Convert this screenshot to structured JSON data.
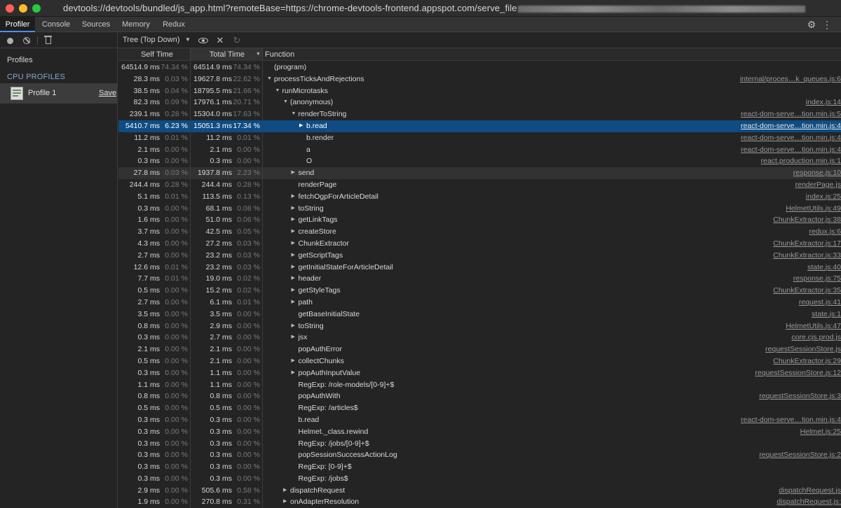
{
  "window": {
    "title": "devtools://devtools/bundled/js_app.html?remoteBase=https://chrome-devtools-frontend.appspot.com/serve_file"
  },
  "tabs": [
    {
      "label": "Profiler",
      "active": true
    },
    {
      "label": "Console",
      "active": false
    },
    {
      "label": "Sources",
      "active": false
    },
    {
      "label": "Memory",
      "active": false
    },
    {
      "label": "Redux",
      "active": false
    }
  ],
  "icons": {
    "settings": "gear-icon",
    "more": "more-vertical-icon",
    "record": "record-icon",
    "clear": "clear-icon",
    "trash": "trash-icon",
    "focus": "eye-icon",
    "exclude": "close-icon",
    "restore": "reload-icon"
  },
  "sidebar": {
    "profiles_label": "Profiles",
    "cpu_profiles_label": "CPU PROFILES",
    "profile_name": "Profile 1",
    "save_label": "Save"
  },
  "toolbar": {
    "view_mode": "Tree (Top Down)"
  },
  "columns": {
    "self": "Self Time",
    "total": "Total Time",
    "function": "Function"
  },
  "colors": {
    "selected_row": "#0e4c83",
    "active_tab_underline": "#4c8df6"
  },
  "rows": [
    {
      "self_ms": "64514.9 ms",
      "self_pct": "74.34 %",
      "total_ms": "64514.9 ms",
      "total_pct": "74.34 %",
      "depth": 0,
      "expander": "",
      "name": "(program)",
      "url": ""
    },
    {
      "self_ms": "28.3 ms",
      "self_pct": "0.03 %",
      "total_ms": "19627.8 ms",
      "total_pct": "22.62 %",
      "depth": 0,
      "expander": "down",
      "name": "processTicksAndRejections",
      "url": "internal/proces…k_queues.js:6"
    },
    {
      "self_ms": "38.5 ms",
      "self_pct": "0.04 %",
      "total_ms": "18795.5 ms",
      "total_pct": "21.66 %",
      "depth": 1,
      "expander": "down",
      "name": "runMicrotasks",
      "url": ""
    },
    {
      "self_ms": "82.3 ms",
      "self_pct": "0.09 %",
      "total_ms": "17976.1 ms",
      "total_pct": "20.71 %",
      "depth": 2,
      "expander": "down",
      "name": "(anonymous)",
      "url": "index.js:14"
    },
    {
      "self_ms": "239.1 ms",
      "self_pct": "0.28 %",
      "total_ms": "15304.0 ms",
      "total_pct": "17.63 %",
      "depth": 3,
      "expander": "down",
      "name": "renderToString",
      "url": "react-dom-serve…tion.min.js:5"
    },
    {
      "self_ms": "5410.7 ms",
      "self_pct": "6.23 %",
      "total_ms": "15051.3 ms",
      "total_pct": "17.34 %",
      "depth": 4,
      "expander": "right",
      "name": "b.read",
      "url": "react-dom-serve…tion.min.js:4",
      "selected": true
    },
    {
      "self_ms": "11.2 ms",
      "self_pct": "0.01 %",
      "total_ms": "11.2 ms",
      "total_pct": "0.01 %",
      "depth": 4,
      "expander": "",
      "name": "b.render",
      "url": "react-dom-serve…tion.min.js:4"
    },
    {
      "self_ms": "2.1 ms",
      "self_pct": "0.00 %",
      "total_ms": "2.1 ms",
      "total_pct": "0.00 %",
      "depth": 4,
      "expander": "",
      "name": "a",
      "url": "react-dom-serve…tion.min.js:4"
    },
    {
      "self_ms": "0.3 ms",
      "self_pct": "0.00 %",
      "total_ms": "0.3 ms",
      "total_pct": "0.00 %",
      "depth": 4,
      "expander": "",
      "name": "O",
      "url": "react.production.min.js:1"
    },
    {
      "self_ms": "27.8 ms",
      "self_pct": "0.03 %",
      "total_ms": "1937.8 ms",
      "total_pct": "2.23 %",
      "depth": 3,
      "expander": "right",
      "name": "send",
      "url": "response.js:10",
      "shaded": true
    },
    {
      "self_ms": "244.4 ms",
      "self_pct": "0.28 %",
      "total_ms": "244.4 ms",
      "total_pct": "0.28 %",
      "depth": 3,
      "expander": "",
      "name": "renderPage",
      "url": "renderPage.js"
    },
    {
      "self_ms": "5.1 ms",
      "self_pct": "0.01 %",
      "total_ms": "113.5 ms",
      "total_pct": "0.13 %",
      "depth": 3,
      "expander": "right",
      "name": "fetchOgpForArticleDetail",
      "url": "index.js:25"
    },
    {
      "self_ms": "0.3 ms",
      "self_pct": "0.00 %",
      "total_ms": "68.1 ms",
      "total_pct": "0.08 %",
      "depth": 3,
      "expander": "right",
      "name": "toString",
      "url": "HelmetUtils.js:49"
    },
    {
      "self_ms": "1.6 ms",
      "self_pct": "0.00 %",
      "total_ms": "51.0 ms",
      "total_pct": "0.06 %",
      "depth": 3,
      "expander": "right",
      "name": "getLinkTags",
      "url": "ChunkExtractor.js:38"
    },
    {
      "self_ms": "3.7 ms",
      "self_pct": "0.00 %",
      "total_ms": "42.5 ms",
      "total_pct": "0.05 %",
      "depth": 3,
      "expander": "right",
      "name": "createStore",
      "url": "redux.js:6"
    },
    {
      "self_ms": "4.3 ms",
      "self_pct": "0.00 %",
      "total_ms": "27.2 ms",
      "total_pct": "0.03 %",
      "depth": 3,
      "expander": "right",
      "name": "ChunkExtractor",
      "url": "ChunkExtractor.js:17"
    },
    {
      "self_ms": "2.7 ms",
      "self_pct": "0.00 %",
      "total_ms": "23.2 ms",
      "total_pct": "0.03 %",
      "depth": 3,
      "expander": "right",
      "name": "getScriptTags",
      "url": "ChunkExtractor.js:33"
    },
    {
      "self_ms": "12.6 ms",
      "self_pct": "0.01 %",
      "total_ms": "23.2 ms",
      "total_pct": "0.03 %",
      "depth": 3,
      "expander": "right",
      "name": "getInitialStateForArticleDetail",
      "url": "state.js:40"
    },
    {
      "self_ms": "7.7 ms",
      "self_pct": "0.01 %",
      "total_ms": "19.0 ms",
      "total_pct": "0.02 %",
      "depth": 3,
      "expander": "right",
      "name": "header",
      "url": "response.js:75"
    },
    {
      "self_ms": "0.5 ms",
      "self_pct": "0.00 %",
      "total_ms": "15.2 ms",
      "total_pct": "0.02 %",
      "depth": 3,
      "expander": "right",
      "name": "getStyleTags",
      "url": "ChunkExtractor.js:35"
    },
    {
      "self_ms": "2.7 ms",
      "self_pct": "0.00 %",
      "total_ms": "6.1 ms",
      "total_pct": "0.01 %",
      "depth": 3,
      "expander": "right",
      "name": "path",
      "url": "request.js:41"
    },
    {
      "self_ms": "3.5 ms",
      "self_pct": "0.00 %",
      "total_ms": "3.5 ms",
      "total_pct": "0.00 %",
      "depth": 3,
      "expander": "",
      "name": "getBaseInitialState",
      "url": "state.js:1"
    },
    {
      "self_ms": "0.8 ms",
      "self_pct": "0.00 %",
      "total_ms": "2.9 ms",
      "total_pct": "0.00 %",
      "depth": 3,
      "expander": "right",
      "name": "toString",
      "url": "HelmetUtils.js:47"
    },
    {
      "self_ms": "0.3 ms",
      "self_pct": "0.00 %",
      "total_ms": "2.7 ms",
      "total_pct": "0.00 %",
      "depth": 3,
      "expander": "right",
      "name": "jsx",
      "url": "core.cjs.prod.js"
    },
    {
      "self_ms": "2.1 ms",
      "self_pct": "0.00 %",
      "total_ms": "2.1 ms",
      "total_pct": "0.00 %",
      "depth": 3,
      "expander": "",
      "name": "popAuthError",
      "url": "requestSessionStore.js"
    },
    {
      "self_ms": "0.5 ms",
      "self_pct": "0.00 %",
      "total_ms": "2.1 ms",
      "total_pct": "0.00 %",
      "depth": 3,
      "expander": "right",
      "name": "collectChunks",
      "url": "ChunkExtractor.js:29"
    },
    {
      "self_ms": "0.3 ms",
      "self_pct": "0.00 %",
      "total_ms": "1.1 ms",
      "total_pct": "0.00 %",
      "depth": 3,
      "expander": "right",
      "name": "popAuthInputValue",
      "url": "requestSessionStore.js:12"
    },
    {
      "self_ms": "1.1 ms",
      "self_pct": "0.00 %",
      "total_ms": "1.1 ms",
      "total_pct": "0.00 %",
      "depth": 3,
      "expander": "",
      "name": "RegExp: /role-models/[0-9]+$",
      "url": ""
    },
    {
      "self_ms": "0.8 ms",
      "self_pct": "0.00 %",
      "total_ms": "0.8 ms",
      "total_pct": "0.00 %",
      "depth": 3,
      "expander": "",
      "name": "popAuthWith",
      "url": "requestSessionStore.js:3"
    },
    {
      "self_ms": "0.5 ms",
      "self_pct": "0.00 %",
      "total_ms": "0.5 ms",
      "total_pct": "0.00 %",
      "depth": 3,
      "expander": "",
      "name": "RegExp: /articles$",
      "url": ""
    },
    {
      "self_ms": "0.3 ms",
      "self_pct": "0.00 %",
      "total_ms": "0.3 ms",
      "total_pct": "0.00 %",
      "depth": 3,
      "expander": "",
      "name": "b.read",
      "url": "react-dom-serve…tion.min.js:4"
    },
    {
      "self_ms": "0.3 ms",
      "self_pct": "0.00 %",
      "total_ms": "0.3 ms",
      "total_pct": "0.00 %",
      "depth": 3,
      "expander": "",
      "name": "Helmet._class.rewind",
      "url": "Helmet.js:25"
    },
    {
      "self_ms": "0.3 ms",
      "self_pct": "0.00 %",
      "total_ms": "0.3 ms",
      "total_pct": "0.00 %",
      "depth": 3,
      "expander": "",
      "name": "RegExp: /jobs/[0-9]+$",
      "url": ""
    },
    {
      "self_ms": "0.3 ms",
      "self_pct": "0.00 %",
      "total_ms": "0.3 ms",
      "total_pct": "0.00 %",
      "depth": 3,
      "expander": "",
      "name": "popSessionSuccessActionLog",
      "url": "requestSessionStore.js:2"
    },
    {
      "self_ms": "0.3 ms",
      "self_pct": "0.00 %",
      "total_ms": "0.3 ms",
      "total_pct": "0.00 %",
      "depth": 3,
      "expander": "",
      "name": "RegExp: [0-9]+$",
      "url": ""
    },
    {
      "self_ms": "0.3 ms",
      "self_pct": "0.00 %",
      "total_ms": "0.3 ms",
      "total_pct": "0.00 %",
      "depth": 3,
      "expander": "",
      "name": "RegExp: /jobs$",
      "url": ""
    },
    {
      "self_ms": "2.9 ms",
      "self_pct": "0.00 %",
      "total_ms": "505.6 ms",
      "total_pct": "0.58 %",
      "depth": 2,
      "expander": "right",
      "name": "dispatchRequest",
      "url": "dispatchRequest.js"
    },
    {
      "self_ms": "1.9 ms",
      "self_pct": "0.00 %",
      "total_ms": "270.8 ms",
      "total_pct": "0.31 %",
      "depth": 2,
      "expander": "right",
      "name": "onAdapterResolution",
      "url": "dispatchRequest.js:"
    }
  ]
}
